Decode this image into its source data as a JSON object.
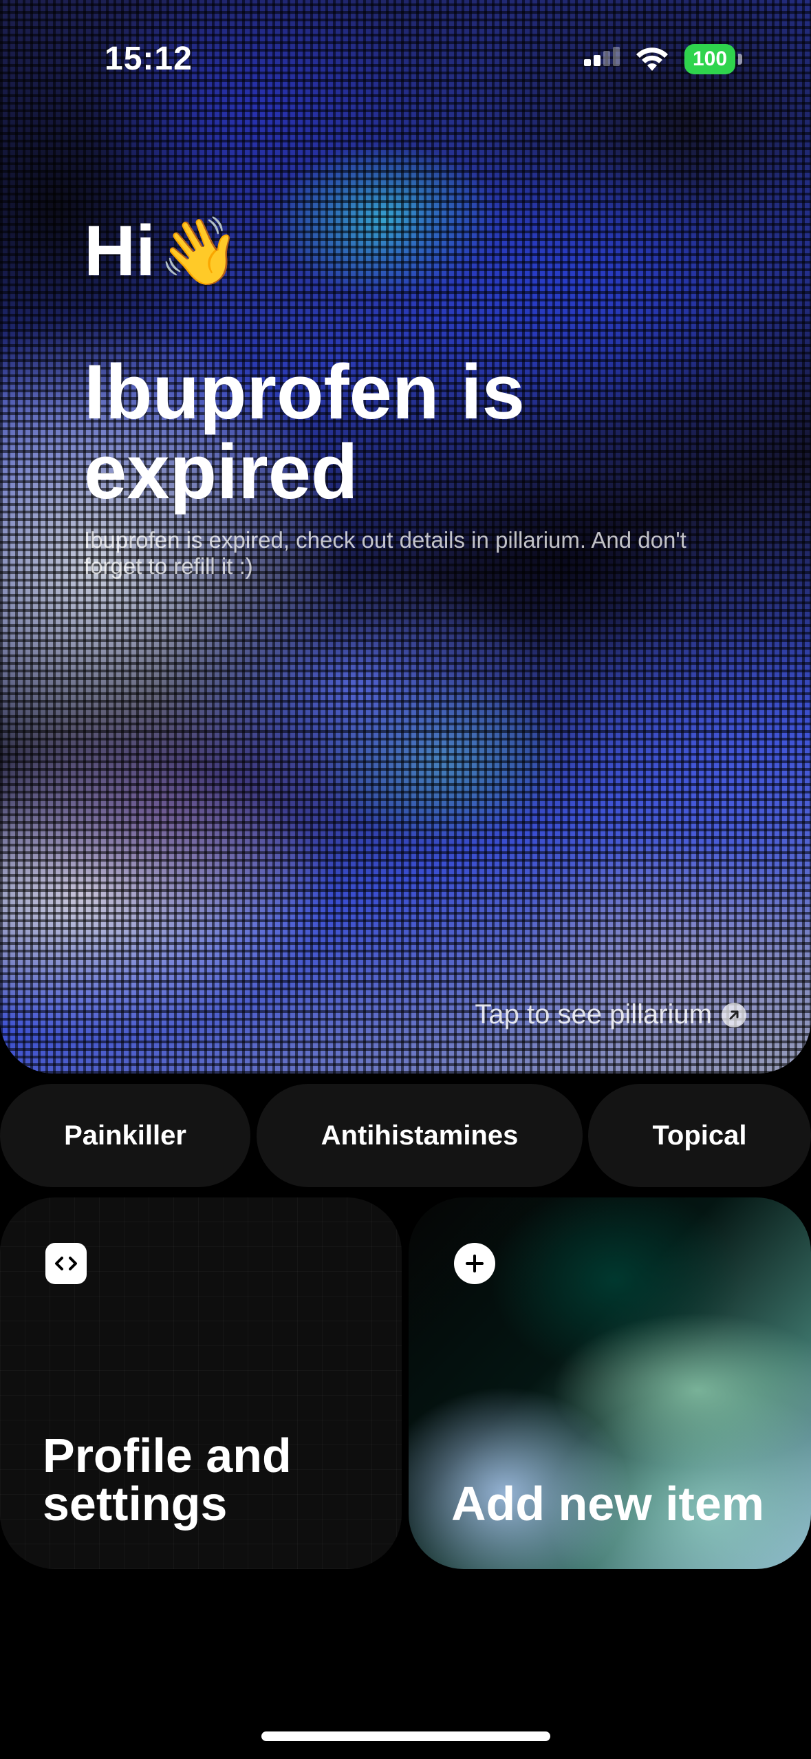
{
  "status_bar": {
    "time": "15:12",
    "battery": "100",
    "battery_color": "#2fd44d"
  },
  "hero": {
    "greeting": "Hi",
    "greeting_emoji": "👋",
    "headline": "Ibuprofen is expired",
    "subtext": "Ibuprofen is expired, check out details in pillarium. And don't forget to refill it :)",
    "tap_link": "Tap to see pillarium"
  },
  "categories": [
    {
      "label": "Painkiller"
    },
    {
      "label": "Antihistamines"
    },
    {
      "label": "Topical"
    }
  ],
  "cards": {
    "profile": {
      "title": "Profile and settings",
      "icon": "code-icon"
    },
    "add": {
      "title": "Add new item",
      "icon": "plus-icon"
    }
  }
}
